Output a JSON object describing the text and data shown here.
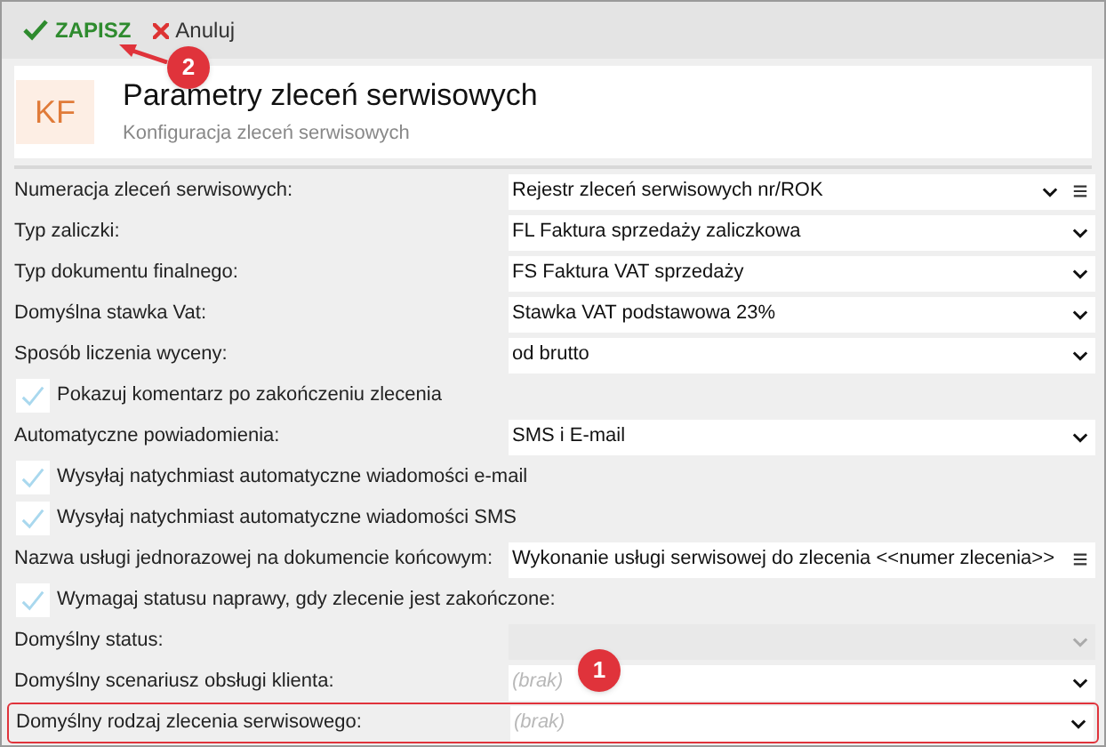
{
  "toolbar": {
    "buttons": [
      {
        "kind": "save",
        "label": "ZAPISZ"
      },
      {
        "kind": "cancel",
        "label": "Anuluj"
      }
    ]
  },
  "header": {
    "logo": "KF",
    "title": "Parametry zleceń serwisowych",
    "subtitle": "Konfiguracja zleceń serwisowych"
  },
  "rows": [
    {
      "kind": "select",
      "label": "Numeracja zleceń serwisowych:",
      "value": "Rejestr zleceń serwisowych nr/ROK",
      "menu": true
    },
    {
      "kind": "select",
      "label": "Typ zaliczki:",
      "value": "FL  Faktura sprzedaży zaliczkowa"
    },
    {
      "kind": "select",
      "label": "Typ dokumentu finalnego:",
      "value": "FS  Faktura VAT sprzedaży"
    },
    {
      "kind": "select",
      "label": "Domyślna stawka Vat:",
      "value": "Stawka VAT podstawowa 23%"
    },
    {
      "kind": "select",
      "label": "Sposób liczenia wyceny:",
      "value": "od brutto"
    },
    {
      "kind": "checkbox",
      "label": "Pokazuj komentarz po zakończeniu zlecenia",
      "checked": true
    },
    {
      "kind": "select",
      "label": "Automatyczne powiadomienia:",
      "value": "SMS i E-mail"
    },
    {
      "kind": "checkbox",
      "label": "Wysyłaj natychmiast automatyczne wiadomości e-mail",
      "checked": true
    },
    {
      "kind": "checkbox",
      "label": "Wysyłaj natychmiast automatyczne wiadomości SMS",
      "checked": true
    },
    {
      "kind": "text",
      "label": "Nazwa usługi jednorazowej na dokumencie końcowym:",
      "value": "Wykonanie usługi serwisowej do zlecenia <<numer zlecenia>>",
      "menu": true
    },
    {
      "kind": "checkbox",
      "label": "Wymagaj statusu naprawy, gdy zlecenie jest zakończone:",
      "checked": true
    },
    {
      "kind": "select",
      "label": "Domyślny status:",
      "disabled": true
    },
    {
      "kind": "select",
      "label": "Domyślny scenariusz obsługi klienta:",
      "placeholder": "(brak)"
    },
    {
      "kind": "select",
      "label": "Domyślny rodzaj zlecenia serwisowego:",
      "placeholder": "(brak)",
      "highlighted": true
    }
  ],
  "annotations": [
    {
      "text": "2"
    },
    {
      "text": "1"
    }
  ]
}
